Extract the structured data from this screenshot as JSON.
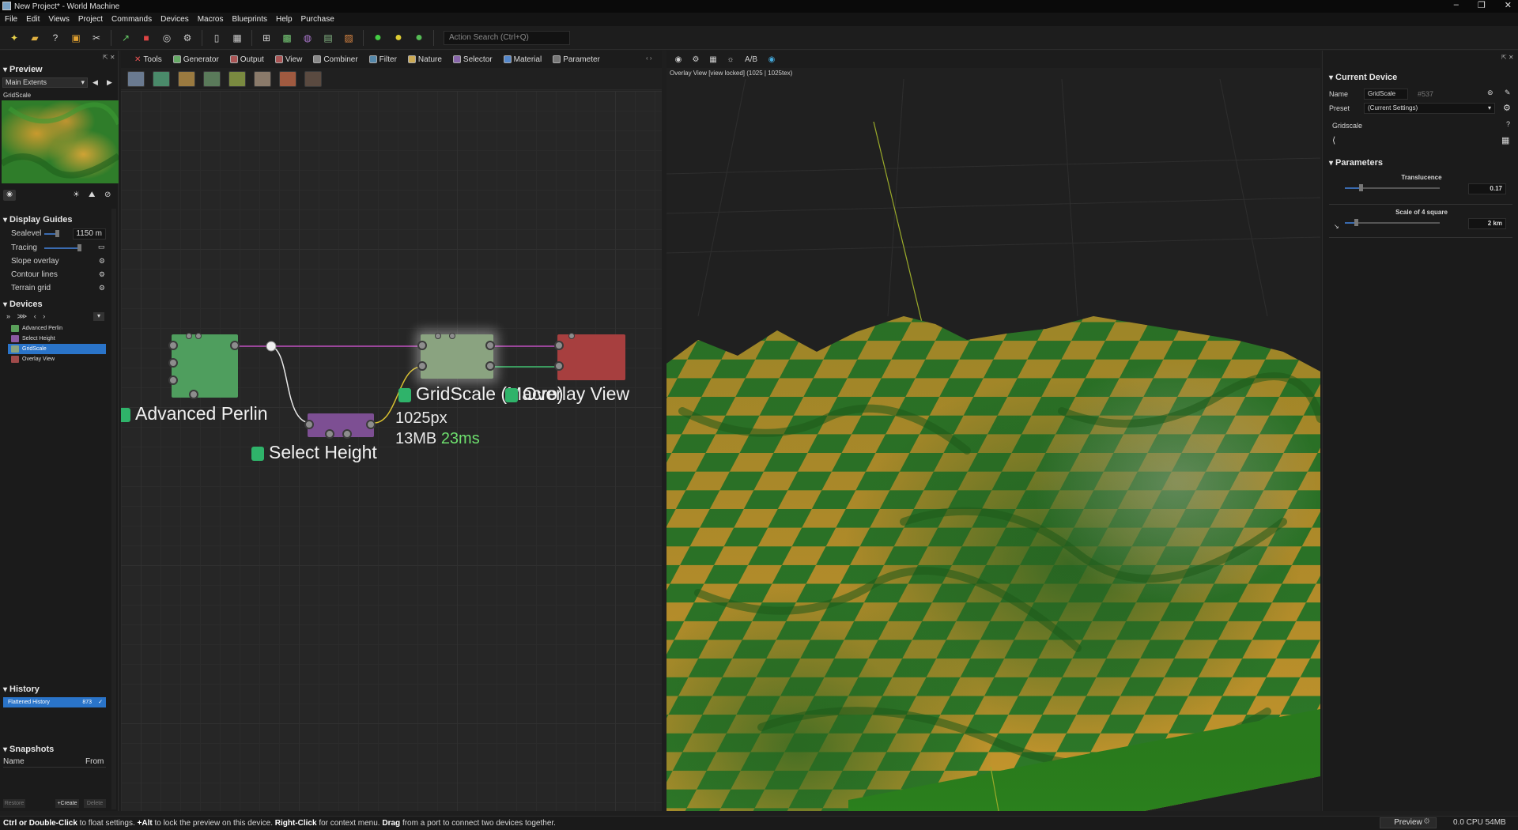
{
  "window": {
    "title": "New Project* - World Machine"
  },
  "menu": [
    "File",
    "Edit",
    "Views",
    "Project",
    "Commands",
    "Devices",
    "Macros",
    "Blueprints",
    "Help",
    "Purchase"
  ],
  "toolbar": {
    "search_placeholder": "Action Search (Ctrl+Q)"
  },
  "preview": {
    "title": "Preview",
    "extents": "Main Extents",
    "device": "GridScale"
  },
  "display_guides": {
    "title": "Display Guides",
    "sealevel_label": "Sealevel",
    "sealevel_value": "1150 m",
    "tracing_label": "Tracing",
    "slope_label": "Slope overlay",
    "contour_label": "Contour lines",
    "terrain_grid_label": "Terrain grid"
  },
  "devices": {
    "title": "Devices",
    "items": [
      "Advanced Perlin",
      "Select Height",
      "GridScale",
      "Overlay View"
    ]
  },
  "history": {
    "title": "History",
    "item": "Flattened History",
    "count": "873"
  },
  "snapshots": {
    "title": "Snapshots",
    "col_name": "Name",
    "col_from": "From",
    "restore": "Restore",
    "create": "+Create",
    "delete": "Delete"
  },
  "tabs": [
    "Tools",
    "Generator",
    "Output",
    "View",
    "Combiner",
    "Filter",
    "Nature",
    "Selector",
    "Material",
    "Parameter"
  ],
  "graph": {
    "node_perlin": "Advanced Perlin",
    "node_select": "Select Height",
    "node_gridscale": "GridScale (Macro)",
    "node_overlay": "Overlay View",
    "info_res": "1025px",
    "info_mem": "13MB",
    "info_time": "23ms"
  },
  "viewport": {
    "caption": "Overlay View [view locked] (1025 | 1025tex)"
  },
  "current_device": {
    "title": "Current Device",
    "name_label": "Name",
    "name_value": "GridScale",
    "id": "#537",
    "preset_label": "Preset",
    "preset_value": "(Current Settings)",
    "device_type": "Gridscale",
    "help": "?"
  },
  "parameters": {
    "title": "Parameters",
    "translucence_label": "Translucence",
    "translucence_value": "0.17",
    "translucence_level": 0.17,
    "scale_label": "Scale of 4 square",
    "scale_value": "2 km"
  },
  "statusbar": {
    "hint_a": "Ctrl or Double-Click",
    "hint_b": " to float settings. ",
    "hint_c": "+Alt",
    "hint_d": " to lock the preview on this device. ",
    "hint_e": "Right-Click",
    "hint_f": " for context menu. ",
    "hint_g": "Drag",
    "hint_h": " from a port to connect two devices together.",
    "preview_button": "Preview",
    "cpu_mem": "0.0 CPU 54MB"
  },
  "colors": {
    "selection": "#2a74c9",
    "node_perlin": "#4f9e5e",
    "node_select": "#7d4f93",
    "node_gridscale": "#8aa380",
    "node_overlay": "#a73f3f",
    "terrain_green": "#2f7d2a",
    "terrain_yellow": "#c99a2e"
  }
}
